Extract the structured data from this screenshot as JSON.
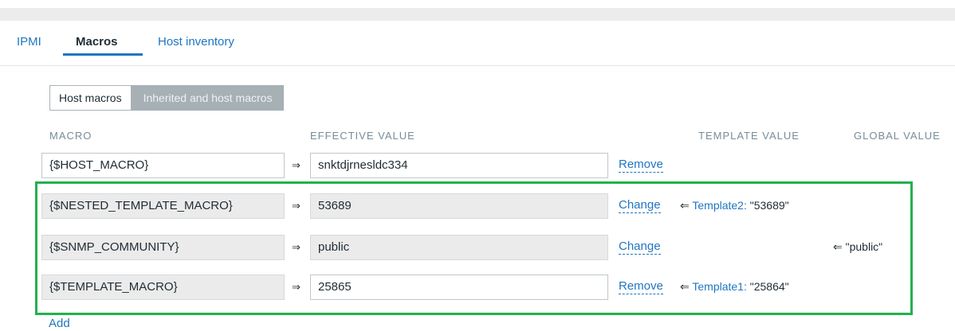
{
  "tabs": [
    {
      "label": "IPMI"
    },
    {
      "label": "Macros"
    },
    {
      "label": "Host inventory"
    }
  ],
  "toggle": {
    "host_macros": "Host macros",
    "inherited_macros": "Inherited and host macros"
  },
  "columns": {
    "macro": "MACRO",
    "effective": "EFFECTIVE VALUE",
    "template": "TEMPLATE VALUE",
    "global": "GLOBAL VALUE"
  },
  "arrow_right": "⇒",
  "arrow_left": "⇐",
  "rows": [
    {
      "macro": "{$HOST_MACRO}",
      "value": "snktdjrnesldc334",
      "action": "Remove"
    },
    {
      "macro": "{$NESTED_TEMPLATE_MACRO}",
      "value": "53689",
      "action": "Change",
      "template_link": "Template2:",
      "template_value": "\"53689\""
    },
    {
      "macro": "{$SNMP_COMMUNITY}",
      "value": "public",
      "action": "Change",
      "global_value": "\"public\""
    },
    {
      "macro": "{$TEMPLATE_MACRO}",
      "value": "25865",
      "action": "Remove",
      "template_link": "Template1:",
      "template_value": "\"25864\""
    }
  ],
  "add_label": "Add",
  "colors": {
    "link": "#1f75c2",
    "highlight_border": "#22b14c",
    "inherited_field_bg": "#ebebeb"
  }
}
